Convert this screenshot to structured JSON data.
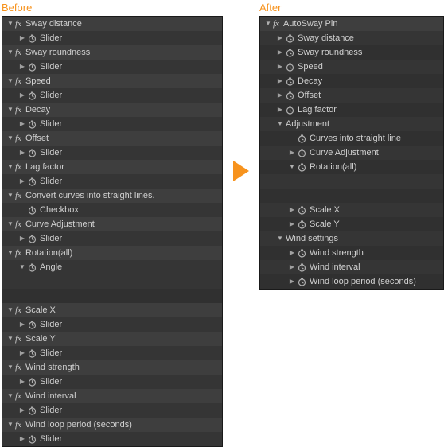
{
  "titles": {
    "before": "Before",
    "after": "After"
  },
  "before": {
    "effects": [
      {
        "name": "Sway distance",
        "prop": "Slider"
      },
      {
        "name": "Sway roundness",
        "prop": "Slider"
      },
      {
        "name": "Speed",
        "prop": "Slider"
      },
      {
        "name": "Decay",
        "prop": "Slider"
      },
      {
        "name": "Offset",
        "prop": "Slider"
      },
      {
        "name": "Lag factor",
        "prop": "Slider"
      },
      {
        "name": "Convert curves into straight lines.",
        "prop": "Checkbox",
        "noArrow": true
      },
      {
        "name": "Curve Adjustment",
        "prop": "Slider"
      },
      {
        "name": "Rotation(all)",
        "prop": "Angle",
        "angleOpen": true
      }
    ],
    "effects2": [
      {
        "name": "Scale X",
        "prop": "Slider"
      },
      {
        "name": "Scale Y",
        "prop": "Slider"
      },
      {
        "name": "Wind strength",
        "prop": "Slider"
      },
      {
        "name": "Wind interval",
        "prop": "Slider"
      },
      {
        "name": "Wind loop period (seconds)",
        "prop": "Slider"
      }
    ]
  },
  "after": {
    "effect": "AutoSway Pin",
    "props": [
      "Sway distance",
      "Sway roundness",
      "Speed",
      "Decay",
      "Offset",
      "Lag factor"
    ],
    "adjustment": {
      "label": "Adjustment",
      "items": [
        {
          "label": "Curves into straight line",
          "hasArrow": false
        },
        {
          "label": "Curve Adjustment",
          "hasArrow": true
        },
        {
          "label": "Rotation(all)",
          "hasArrow": true,
          "open": true
        }
      ]
    },
    "scale": [
      "Scale X",
      "Scale Y"
    ],
    "wind": {
      "label": "Wind settings",
      "items": [
        "Wind strength",
        "Wind interval",
        "Wind loop period (seconds)"
      ]
    }
  }
}
